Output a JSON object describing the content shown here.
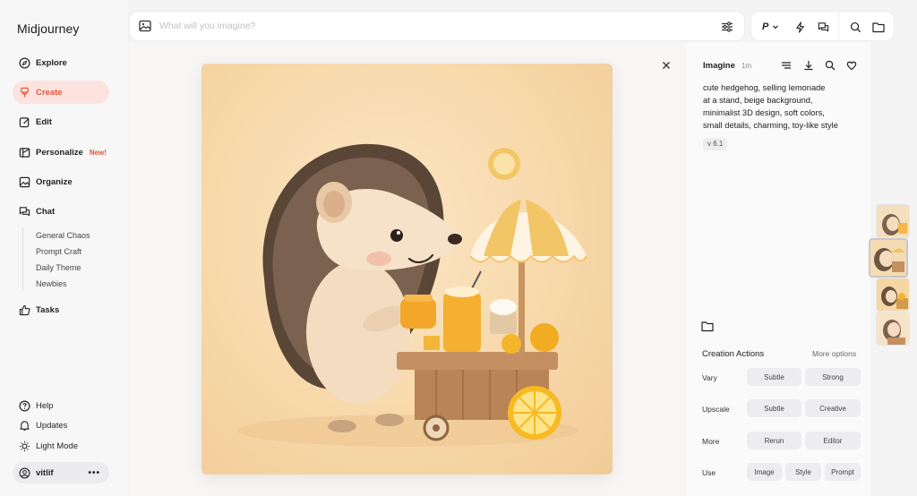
{
  "app": {
    "name": "Midjourney"
  },
  "sidebar": {
    "items": [
      {
        "label": "Explore",
        "icon": "compass-icon"
      },
      {
        "label": "Create",
        "icon": "brush-icon",
        "active": true
      },
      {
        "label": "Edit",
        "icon": "edit-icon"
      },
      {
        "label": "Personalize",
        "icon": "personalize-icon",
        "badge": "New!"
      },
      {
        "label": "Organize",
        "icon": "image-icon"
      },
      {
        "label": "Chat",
        "icon": "chat-icon"
      }
    ],
    "chat_rooms": [
      "General Chaos",
      "Prompt Craft",
      "Daily Theme",
      "Newbies"
    ],
    "tasks_label": "Tasks",
    "bottom": [
      {
        "label": "Help",
        "icon": "help-icon"
      },
      {
        "label": "Updates",
        "icon": "bell-icon"
      },
      {
        "label": "Light Mode",
        "icon": "sun-icon"
      }
    ],
    "user": {
      "name": "vitlif",
      "more": "•••"
    }
  },
  "search": {
    "placeholder": "What will you imagine?",
    "value": ""
  },
  "toolbar": {
    "personalize_letter": "P"
  },
  "image": {
    "alt_icon": "hedgehog-lemonade-artwork"
  },
  "details": {
    "title": "Imagine",
    "time": "1m",
    "prompt_lines": [
      "cute hedgehog, selling lemonade",
      "at a stand, beige background,",
      "minimalist 3D design, soft colors,",
      "small details, charming, toy-like style"
    ],
    "version": "v 6.1",
    "creation_actions_title": "Creation Actions",
    "more_options": "More options",
    "rows": [
      {
        "label": "Vary",
        "buttons": [
          "Subtle",
          "Strong"
        ]
      },
      {
        "label": "Upscale",
        "buttons": [
          "Subtle",
          "Creative"
        ]
      },
      {
        "label": "More",
        "buttons": [
          "Rerun",
          "Editor"
        ]
      },
      {
        "label": "Use",
        "buttons": [
          "Image",
          "Style",
          "Prompt"
        ]
      }
    ]
  },
  "colors": {
    "accent": "#e8533b",
    "active_bg": "#fde3e0"
  }
}
